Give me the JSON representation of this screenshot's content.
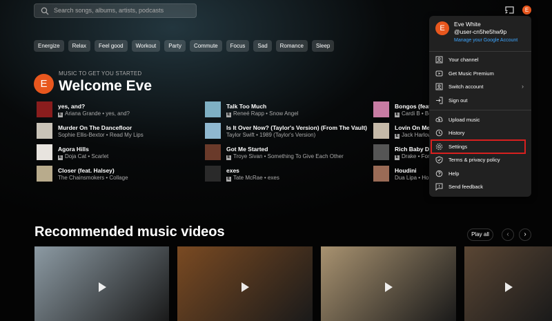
{
  "search": {
    "placeholder": "Search songs, albums, artists, podcasts"
  },
  "header": {
    "avatar_letter": "E"
  },
  "chips": [
    "Energize",
    "Relax",
    "Feel good",
    "Workout",
    "Party",
    "Commute",
    "Focus",
    "Sad",
    "Romance",
    "Sleep"
  ],
  "home": {
    "kicker": "MUSIC TO GET YOU STARTED",
    "welcome": "Welcome Eve",
    "avatar_letter": "E"
  },
  "songs": [
    {
      "title": "yes, and?",
      "sub": "Ariana Grande • yes, and?",
      "explicit": true,
      "color": "#8a1d1d"
    },
    {
      "title": "Murder On The Dancefloor",
      "sub": "Sophie Ellis-Bextor • Read My Lips",
      "explicit": false,
      "color": "#c9c3b8"
    },
    {
      "title": "Agora Hills",
      "sub": "Doja Cat • Scarlet",
      "explicit": true,
      "color": "#e8e4df"
    },
    {
      "title": "Closer (feat. Halsey)",
      "sub": "The Chainsmokers • Collage",
      "explicit": false,
      "color": "#b8ab8c"
    },
    {
      "title": "Talk Too Much",
      "sub": "Reneé Rapp • Snow Angel",
      "explicit": true,
      "color": "#7fb0c4"
    },
    {
      "title": "Is It Over Now? (Taylor's Version) (From The Vault)",
      "sub": "Taylor Swift • 1989 (Taylor's Version)",
      "explicit": false,
      "color": "#8fb8d0"
    },
    {
      "title": "Got Me Started",
      "sub": "Troye Sivan • Something To Give Each Other",
      "explicit": true,
      "color": "#6a3a2a"
    },
    {
      "title": "exes",
      "sub": "Tate McRae • exes",
      "explicit": true,
      "color": "#2a2a2a"
    },
    {
      "title": "Bongos (feat.",
      "sub": "Cardi B • Bo",
      "explicit": true,
      "color": "#c87ca3"
    },
    {
      "title": "Lovin On Me",
      "sub": "Jack Harlow",
      "explicit": true,
      "color": "#c5b9a8"
    },
    {
      "title": "Rich Baby Dad",
      "sub": "Drake • For",
      "explicit": true,
      "color": "#555"
    },
    {
      "title": "Houdini",
      "sub": "Dua Lipa • Hou",
      "explicit": false,
      "color": "#9a6b56"
    }
  ],
  "recommended": {
    "title": "Recommended music videos",
    "play_all": "Play all",
    "prev": "‹",
    "next": "›"
  },
  "videos": [
    {
      "name": "video-1",
      "color": "#8c9aa3"
    },
    {
      "name": "video-2",
      "color": "#7a4a22"
    },
    {
      "name": "video-3",
      "color": "#a89270"
    },
    {
      "name": "video-4",
      "color": "#5a4634"
    }
  ],
  "account_menu": {
    "avatar_letter": "E",
    "name": "Eve White",
    "handle": "@user-cn5he5hw9p",
    "manage": "Manage your Google Account",
    "items": [
      {
        "label": "Your channel",
        "icon": "person-icon"
      },
      {
        "label": "Get Music Premium",
        "icon": "play-badge-icon"
      },
      {
        "label": "Switch account",
        "icon": "switch-account-icon",
        "chevron": "›"
      },
      {
        "label": "Sign out",
        "icon": "sign-out-icon"
      },
      {
        "label": "Upload music",
        "icon": "upload-icon"
      },
      {
        "label": "History",
        "icon": "history-icon"
      },
      {
        "label": "Settings",
        "icon": "gear-icon"
      },
      {
        "label": "Terms & privacy policy",
        "icon": "shield-icon"
      },
      {
        "label": "Help",
        "icon": "help-icon"
      },
      {
        "label": "Send feedback",
        "icon": "feedback-icon"
      }
    ]
  },
  "colors": {
    "accent": "#e8571e",
    "link": "#3ea6ff",
    "highlight": "#d9201f",
    "menu_bg": "#212121"
  }
}
